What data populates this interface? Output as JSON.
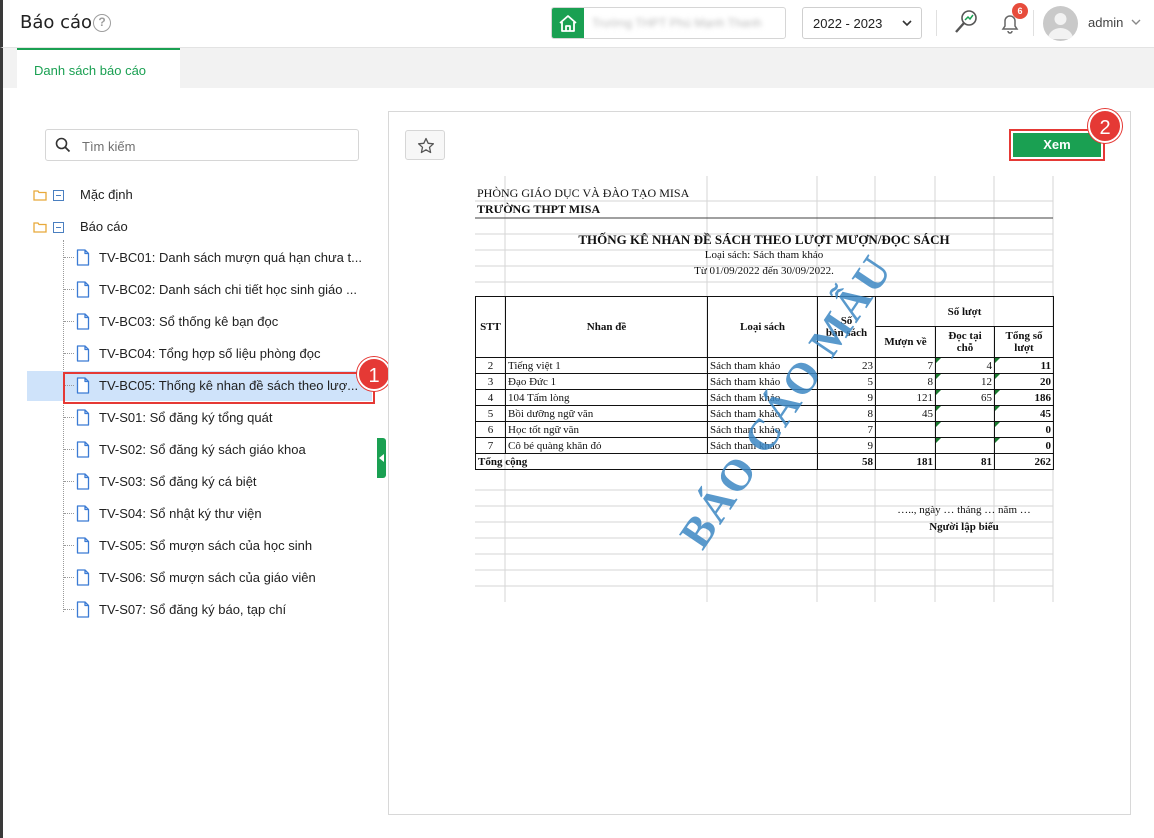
{
  "header": {
    "title": "Báo cáo",
    "help": "?",
    "school_name": "Trường THPT Phú Mạnh Thanh",
    "year": "2022 - 2023",
    "notification_count": "6",
    "user_name": "admin"
  },
  "tabs": [
    {
      "label": "Danh sách báo cáo",
      "active": true
    }
  ],
  "sidebar": {
    "search_placeholder": "Tìm kiếm",
    "folders": [
      {
        "label": "Mặc định"
      },
      {
        "label": "Báo cáo"
      }
    ],
    "items": [
      {
        "label": "TV-BC01: Danh sách mượn quá hạn chưa t..."
      },
      {
        "label": "TV-BC02: Danh sách chi tiết học sinh giáo ..."
      },
      {
        "label": "TV-BC03: Sổ thống kê bạn đọc"
      },
      {
        "label": "TV-BC04: Tổng hợp số liệu phòng đọc"
      },
      {
        "label": "TV-BC05: Thống kê nhan đề sách theo lượ...",
        "selected": true
      },
      {
        "label": "TV-S01: Sổ đăng ký tổng quát"
      },
      {
        "label": "TV-S02: Sổ đăng ký sách giáo khoa"
      },
      {
        "label": "TV-S03: Sổ đăng ký cá biệt"
      },
      {
        "label": "TV-S04: Sổ nhật ký thư viện"
      },
      {
        "label": "TV-S05: Sổ mượn sách của học sinh"
      },
      {
        "label": "TV-S06: Sổ mượn sách của giáo viên"
      },
      {
        "label": "TV-S07: Sổ đăng ký báo, tạp chí"
      }
    ]
  },
  "callouts": {
    "one": "1",
    "two": "2"
  },
  "preview": {
    "view_button": "Xem",
    "report": {
      "org": "PHÒNG GIÁO DỤC VÀ ĐÀO TẠO MISA",
      "school": "TRƯỜNG THPT MISA",
      "title": "THỐNG KÊ NHAN ĐỀ SÁCH THEO LƯỢT MƯỢN/ĐỌC SÁCH",
      "book_type": "Loại sách: Sách tham khảo",
      "period": "Từ  01/09/2022  đến  30/09/2022.",
      "headers": {
        "stt": "STT",
        "title": "Nhan đề",
        "type": "Loại sách",
        "copies_1": "Số",
        "copies_2": "bản sách",
        "turns": "Số lượt",
        "borrow": "Mượn về",
        "read_1": "Đọc tại",
        "read_2": "chỗ",
        "total_1": "Tổng số",
        "total_2": "lượt"
      },
      "rows": [
        {
          "stt": "2",
          "title": "Tiếng việt 1",
          "type": "Sách tham khảo",
          "copies": "23",
          "borrow": "7",
          "read": "4",
          "total": "11"
        },
        {
          "stt": "3",
          "title": "Đạo Đức 1",
          "type": "Sách tham khảo",
          "copies": "5",
          "borrow": "8",
          "read": "12",
          "total": "20"
        },
        {
          "stt": "4",
          "title": "104 Tấm lòng",
          "type": "Sách tham khảo",
          "copies": "9",
          "borrow": "121",
          "read": "65",
          "total": "186"
        },
        {
          "stt": "5",
          "title": "Bồi dưỡng ngữ văn",
          "type": "Sách tham khảo",
          "copies": "8",
          "borrow": "45",
          "read": "",
          "total": "45"
        },
        {
          "stt": "6",
          "title": "Học tốt ngữ văn",
          "type": "Sách tham khảo",
          "copies": "7",
          "borrow": "",
          "read": "",
          "total": "0"
        },
        {
          "stt": "7",
          "title": "Cô bé quàng khăn đỏ",
          "type": "Sách tham khảo",
          "copies": "9",
          "borrow": "",
          "read": "",
          "total": "0"
        }
      ],
      "totals": {
        "label": "Tổng cộng",
        "copies": "58",
        "borrow": "181",
        "read": "81",
        "total": "262"
      },
      "date_line": "….., ngày … tháng … năm …",
      "signer": "Người lập biểu",
      "watermark": "BÁO CÁO MẪU"
    }
  }
}
